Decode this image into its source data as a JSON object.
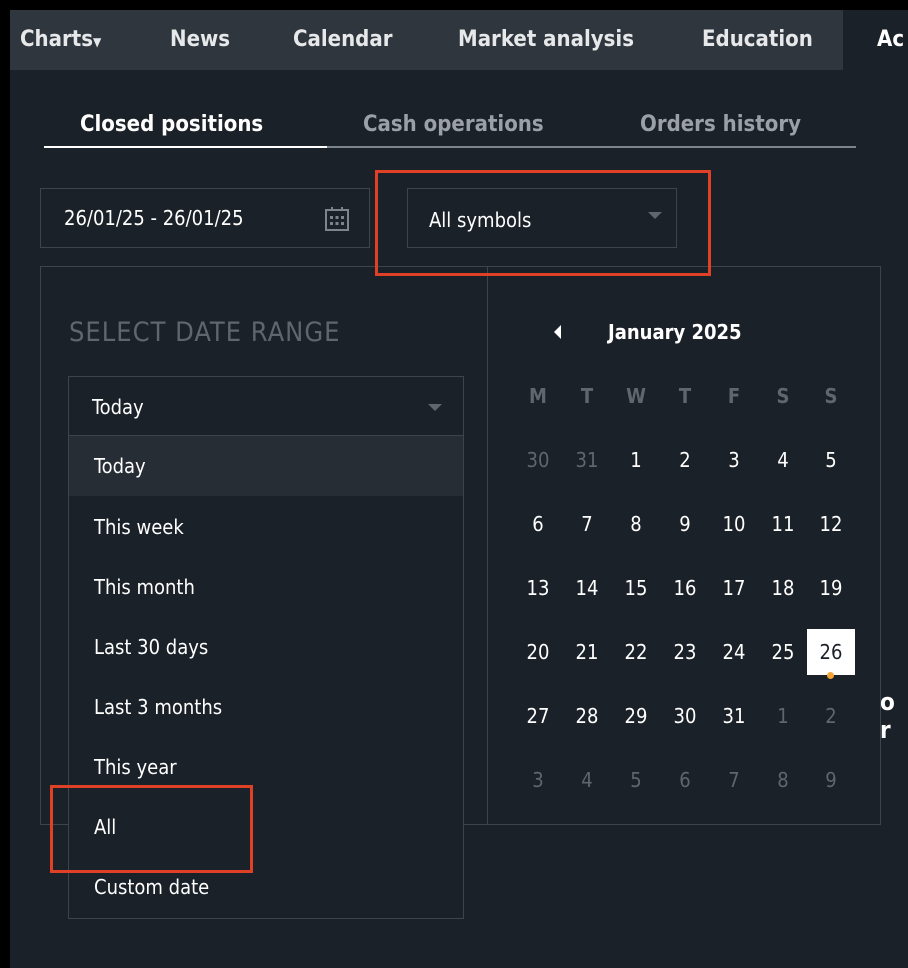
{
  "nav": {
    "items": [
      "Charts",
      "News",
      "Calendar",
      "Market analysis",
      "Education",
      "Ac"
    ]
  },
  "tabs": [
    "Closed positions",
    "Cash operations",
    "Orders history"
  ],
  "date_field": {
    "value": "26/01/25 - 26/01/25",
    "icon": "calendar-icon"
  },
  "symbol_select": {
    "value": "All symbols"
  },
  "date_range": {
    "title": "SELECT DATE RANGE",
    "selected": "Today",
    "options": [
      "Today",
      "This week",
      "This month",
      "Last 30 days",
      "Last 3 months",
      "This year",
      "All",
      "Custom date"
    ]
  },
  "calendar": {
    "month": "January 2025",
    "weekdays": [
      "M",
      "T",
      "W",
      "T",
      "F",
      "S",
      "S"
    ],
    "days": [
      [
        "30",
        "31",
        "1",
        "2",
        "3",
        "4",
        "5"
      ],
      [
        "6",
        "7",
        "8",
        "9",
        "10",
        "11",
        "12"
      ],
      [
        "13",
        "14",
        "15",
        "16",
        "17",
        "18",
        "19"
      ],
      [
        "20",
        "21",
        "22",
        "23",
        "24",
        "25",
        "26"
      ],
      [
        "27",
        "28",
        "29",
        "30",
        "31",
        "1",
        "2"
      ],
      [
        "3",
        "4",
        "5",
        "6",
        "7",
        "8",
        "9"
      ]
    ],
    "selected": "26"
  },
  "background_text": "o r",
  "colors": {
    "highlight": "#e04026",
    "today_dot": "#f2a33a"
  }
}
